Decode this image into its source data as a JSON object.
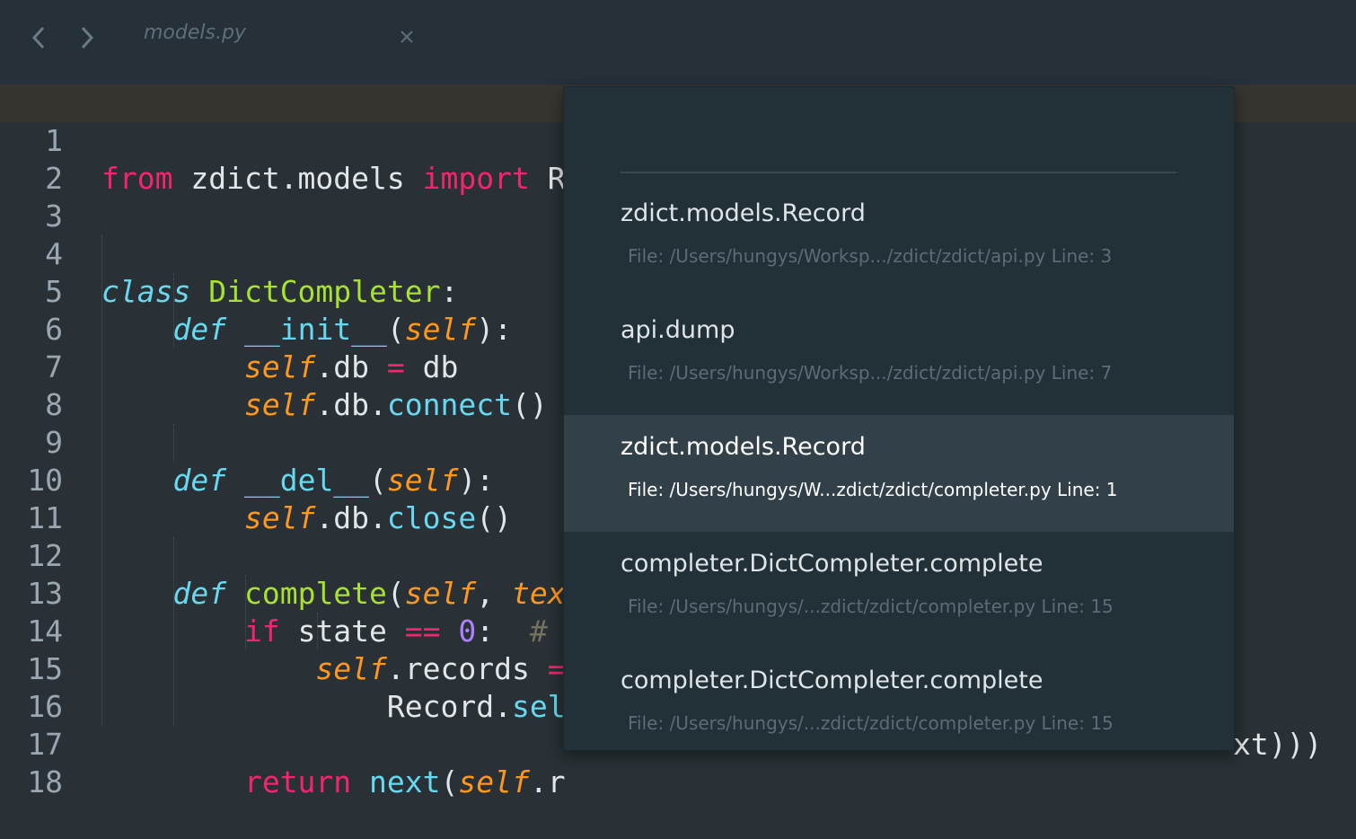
{
  "tab": {
    "title": "models.py",
    "back_icon": "chevron-left-icon",
    "forward_icon": "chevron-right-icon",
    "close_icon": "close-icon"
  },
  "editor": {
    "line_numbers": [
      "1",
      "2",
      "3",
      "4",
      "5",
      "6",
      "7",
      "8",
      "9",
      "10",
      "11",
      "12",
      "13",
      "14",
      "15",
      "16",
      "17",
      "18"
    ],
    "current_line": 1
  },
  "popup": {
    "query": "",
    "items": [
      {
        "title": "zdict.models.Record",
        "detail": "File: /Users/hungys/Worksp.../zdict/zdict/api.py Line: 3"
      },
      {
        "title": "api.dump",
        "detail": "File: /Users/hungys/Worksp.../zdict/zdict/api.py Line: 7"
      },
      {
        "title": "zdict.models.Record",
        "detail": "File: /Users/hungys/W...zdict/zdict/completer.py Line: 1"
      },
      {
        "title": "completer.DictCompleter.complete",
        "detail": "File: /Users/hungys/...zdict/zdict/completer.py Line: 15"
      },
      {
        "title": "completer.DictCompleter.complete",
        "detail": "File: /Users/hungys/...zdict/zdict/completer.py Line: 15"
      }
    ],
    "selected_index": 2
  },
  "colors": {
    "background": "#293136",
    "keyword": "#f2266f",
    "storage": "#67d8ef",
    "class_name": "#a6e22e",
    "self": "#fd971e",
    "number": "#ae81ff"
  }
}
